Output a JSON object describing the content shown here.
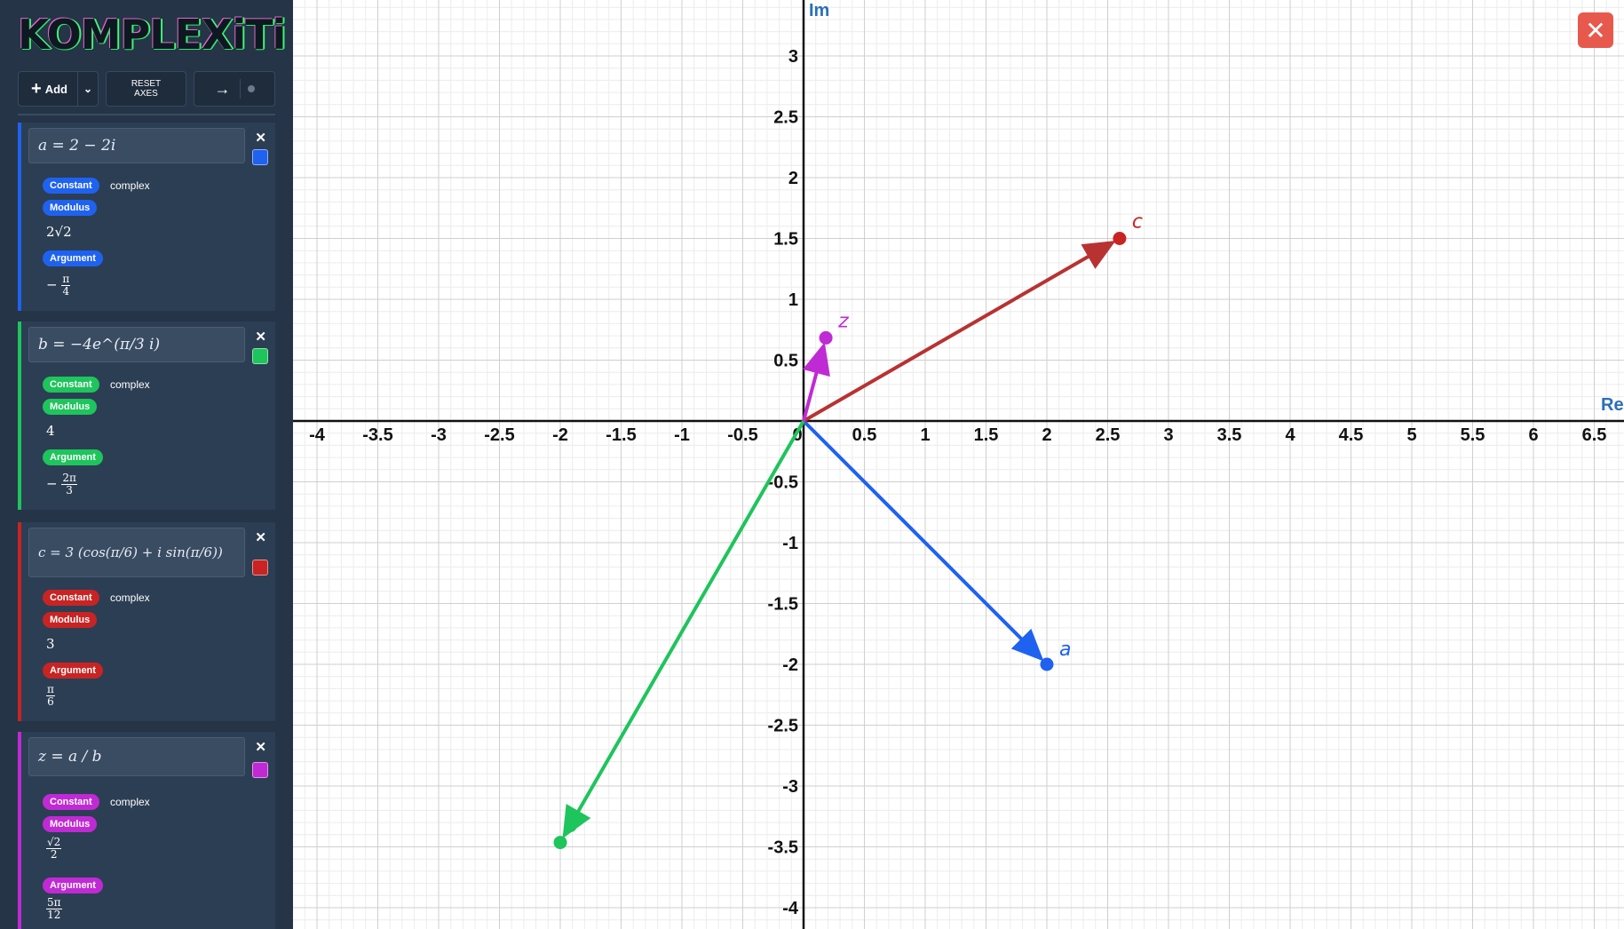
{
  "app": {
    "logo_text": "KOMPLEXiTi"
  },
  "toolbar": {
    "add_label": "Add",
    "reset_label_line1": "RESET",
    "reset_label_line2": "AXES"
  },
  "expressions": [
    {
      "name": "a",
      "expression": "a = 2 − 2i",
      "color": "#1f62f0",
      "badge_constant": "Constant",
      "type": "complex",
      "badge_modulus": "Modulus",
      "modulus": "2√2",
      "badge_argument": "Argument",
      "argument_num": "π",
      "argument_den": "4",
      "argument_sign": "−"
    },
    {
      "name": "b",
      "expression": "b = −4e^(π/3 i)",
      "color": "#1ec45c",
      "badge_constant": "Constant",
      "type": "complex",
      "badge_modulus": "Modulus",
      "modulus": "4",
      "badge_argument": "Argument",
      "argument_num": "2π",
      "argument_den": "3",
      "argument_sign": "−"
    },
    {
      "name": "c",
      "expression": "c = 3 (cos(π/6) + i sin(π/6))",
      "color": "#c82424",
      "badge_constant": "Constant",
      "type": "complex",
      "badge_modulus": "Modulus",
      "modulus": "3",
      "badge_argument": "Argument",
      "argument_num": "π",
      "argument_den": "6",
      "argument_sign": ""
    },
    {
      "name": "z",
      "expression": "z = a / b",
      "color": "#c02ad4",
      "badge_constant": "Constant",
      "type": "complex",
      "badge_modulus": "Modulus",
      "modulus_num": "√2",
      "modulus_den": "2",
      "badge_argument": "Argument",
      "argument_num": "5π",
      "argument_den": "12",
      "argument_sign": ""
    }
  ],
  "plane": {
    "x_axis_label": "Re",
    "y_axis_label": "Im",
    "x_ticks": [
      "-4",
      "-3.5",
      "-3",
      "-2.5",
      "-2",
      "-1.5",
      "-1",
      "-0.5",
      "0",
      "0.5",
      "1",
      "1.5",
      "2",
      "2.5",
      "3",
      "3.5",
      "4",
      "4.5",
      "5",
      "5.5",
      "6",
      "6.5"
    ],
    "y_ticks": [
      "3",
      "2.5",
      "2",
      "1.5",
      "1",
      "0.5",
      "-0.5",
      "-1",
      "-1.5",
      "-2",
      "-2.5",
      "-3",
      "-3.5",
      "-4"
    ]
  },
  "chart_data": {
    "type": "scatter",
    "xlabel": "Re",
    "ylabel": "Im",
    "xlim": [
      -4.2,
      6.7
    ],
    "ylim": [
      -4.2,
      3.5
    ],
    "grid": true,
    "series": [
      {
        "name": "a",
        "x": 2,
        "y": -2,
        "color": "#1f62f0"
      },
      {
        "name": "b",
        "x": -2,
        "y": -3.464,
        "color": "#1ec45c"
      },
      {
        "name": "c",
        "x": 2.598,
        "y": 1.5,
        "color": "#c82424"
      },
      {
        "name": "z",
        "x": 0.183,
        "y": 0.683,
        "color": "#c02ad4"
      }
    ]
  }
}
